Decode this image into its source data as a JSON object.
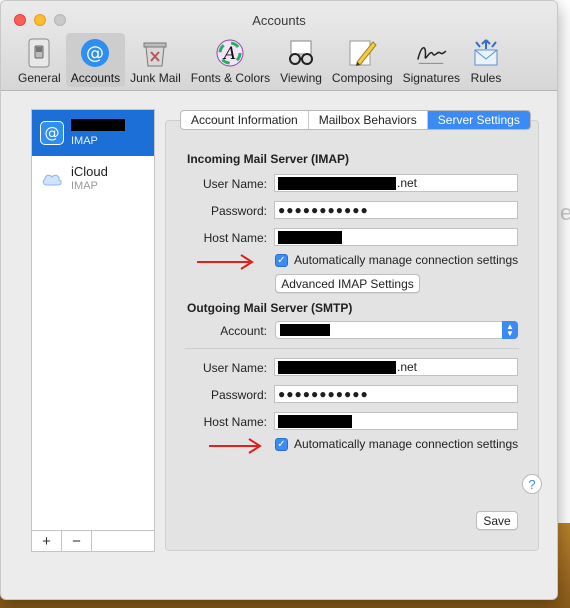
{
  "window": {
    "title": "Accounts"
  },
  "toolbar": {
    "items": [
      {
        "label": "General",
        "icon": "general-switch-icon"
      },
      {
        "label": "Accounts",
        "icon": "at-sign-icon"
      },
      {
        "label": "Junk Mail",
        "icon": "junk-trash-icon"
      },
      {
        "label": "Fonts & Colors",
        "icon": "fonts-colors-icon"
      },
      {
        "label": "Viewing",
        "icon": "glasses-icon"
      },
      {
        "label": "Composing",
        "icon": "pencil-icon"
      },
      {
        "label": "Signatures",
        "icon": "signature-icon"
      },
      {
        "label": "Rules",
        "icon": "rules-envelope-icon"
      }
    ],
    "active": "Accounts"
  },
  "accounts": [
    {
      "name": "",
      "type": "IMAP",
      "selected": true
    },
    {
      "name": "iCloud",
      "type": "IMAP",
      "selected": false
    }
  ],
  "list_buttons": {
    "add": "+",
    "remove": "−"
  },
  "tabs": [
    "Account Information",
    "Mailbox Behaviors",
    "Server Settings"
  ],
  "active_tab": "Server Settings",
  "incoming": {
    "title": "Incoming Mail Server (IMAP)",
    "user_label": "User Name:",
    "user_suffix": ".net",
    "password_label": "Password:",
    "password_value": "●●●●●●●●●●●",
    "host_label": "Host Name:",
    "auto_manage": "Automatically manage connection settings",
    "advanced_button": "Advanced IMAP Settings"
  },
  "outgoing": {
    "title": "Outgoing Mail Server (SMTP)",
    "account_label": "Account:",
    "user_label": "User Name:",
    "user_suffix": ".net",
    "password_label": "Password:",
    "password_value": "●●●●●●●●●●●",
    "host_label": "Host Name:",
    "auto_manage": "Automatically manage connection settings"
  },
  "save_button": "Save",
  "help_button": "?",
  "colors": {
    "accent": "#3c8bf5",
    "selection": "#1d6fd8",
    "annotation_arrow": "#e0201a"
  }
}
